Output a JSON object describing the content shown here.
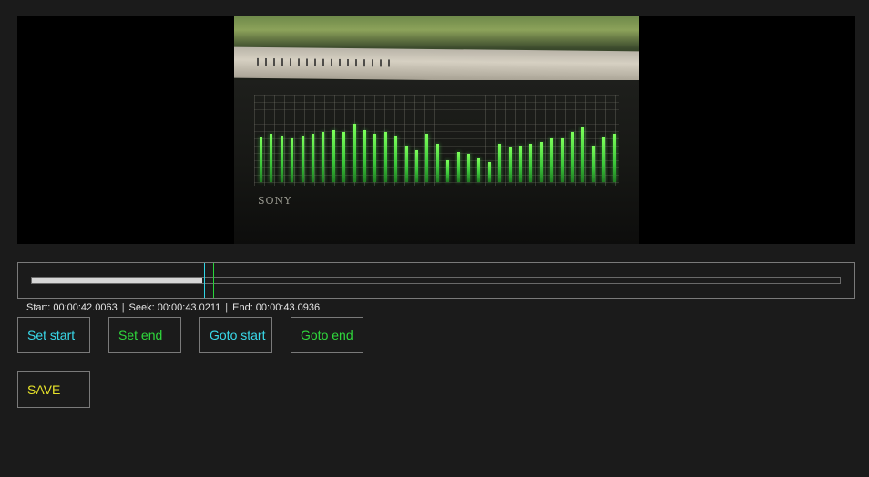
{
  "video": {
    "brand_text": "SONY",
    "levels": [
      0.45,
      0.48,
      0.46,
      0.44,
      0.46,
      0.48,
      0.5,
      0.52,
      0.5,
      0.58,
      0.52,
      0.48,
      0.5,
      0.46,
      0.36,
      0.32,
      0.48,
      0.38,
      0.22,
      0.3,
      0.28,
      0.24,
      0.2,
      0.38,
      0.35,
      0.36,
      0.38,
      0.4,
      0.44,
      0.44,
      0.5,
      0.55,
      0.36,
      0.45,
      0.48
    ]
  },
  "timeline": {
    "progress_fraction": 0.21,
    "seek_fraction": 0.214,
    "end_fraction": 0.2245
  },
  "time_info": {
    "start_label": "Start: 00:00:42.0063",
    "seek_label": "Seek: 00:00:43.0211",
    "end_label": "End: 00:00:43.0936",
    "separator": "|"
  },
  "buttons": {
    "set_start": "Set start",
    "set_end": "Set end",
    "goto_start": "Goto start",
    "goto_end": "Goto end",
    "save": "SAVE"
  },
  "colors": {
    "background": "#1b1b1b",
    "cyan": "#39d9ea",
    "green": "#2fd83c",
    "yellow": "#e8e42a",
    "border": "#7a7a7a"
  }
}
